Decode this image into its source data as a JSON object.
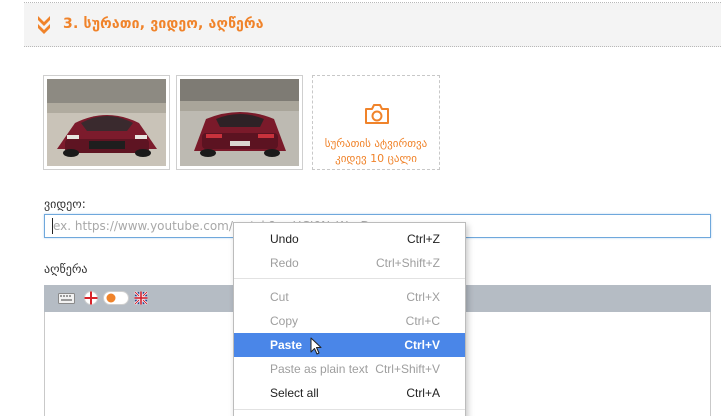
{
  "section": {
    "title": "3. სურათი, ვიდეო, აღწერა"
  },
  "photos": {
    "upload_text": [
      "სურათის ატვირთვა",
      "კიდევ 10 ცალი"
    ],
    "icon": "camera-icon"
  },
  "video": {
    "label": "ვიდეო:",
    "placeholder": "ex. https://www.youtube.com/watch?v=HCJ0N_Wa_Ds"
  },
  "description": {
    "label": "აღწერა",
    "toolbar_icons": [
      "keyboard-icon",
      "georgian-flag-icon",
      "toggle-switch-icon",
      "english-flag-icon"
    ]
  },
  "context_menu": {
    "items": [
      {
        "label": "Undo",
        "shortcut": "Ctrl+Z",
        "state": "enabled"
      },
      {
        "label": "Redo",
        "shortcut": "Ctrl+Shift+Z",
        "state": "disabled"
      },
      {
        "label": "Cut",
        "shortcut": "Ctrl+X",
        "state": "disabled"
      },
      {
        "label": "Copy",
        "shortcut": "Ctrl+C",
        "state": "disabled"
      },
      {
        "label": "Paste",
        "shortcut": "Ctrl+V",
        "state": "active"
      },
      {
        "label": "Paste as plain text",
        "shortcut": "Ctrl+Shift+V",
        "state": "disabled"
      },
      {
        "label": "Select all",
        "shortcut": "Ctrl+A",
        "state": "enabled"
      }
    ]
  },
  "colors": {
    "accent": "#f0832a",
    "toolbar": "#b5bcc4",
    "highlight": "#4a86e8",
    "input_focus": "#6fa8dc"
  }
}
